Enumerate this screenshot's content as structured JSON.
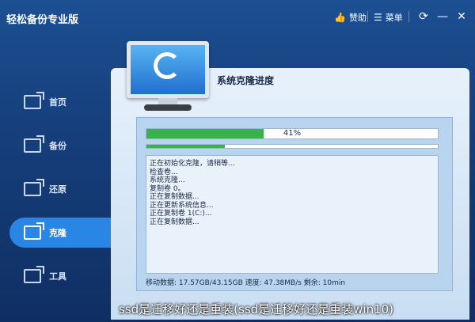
{
  "app": {
    "title": "轻松备份专业版"
  },
  "toolbar": {
    "sponsor_label": "赞助",
    "sponsor_icon": "thumbs-up-icon",
    "menu_label": "菜单",
    "menu_icon": "menu-icon"
  },
  "window": {
    "refresh_icon": "refresh-icon",
    "minimize_icon": "minimize-icon",
    "close_icon": "close-icon"
  },
  "sidebar": {
    "items": [
      {
        "label": "首页",
        "icon": "home-icon"
      },
      {
        "label": "备份",
        "icon": "backup-icon"
      },
      {
        "label": "还原",
        "icon": "restore-icon"
      },
      {
        "label": "克隆",
        "icon": "clone-icon",
        "active": true
      },
      {
        "label": "工具",
        "icon": "tools-icon"
      }
    ]
  },
  "main": {
    "title": "系统克隆进度",
    "progress": {
      "percent_text": "41%",
      "value": 0.41,
      "sub_value": 0.27
    },
    "log": [
      "正在初始化克隆，请稍等...",
      "检查卷...",
      "系统克隆...",
      "复制卷 0。",
      "正在复制数据...",
      "正在更新系统信息...",
      "正在复制卷 1(C:)...",
      "正在复制数据..."
    ],
    "status": "移动数据: 17.57GB/43.15GB 速度: 47.38MB/s 剩余: 10min"
  },
  "caption": "ssd是迁移好还是重装(ssd是迁移好还是重装win10)",
  "colors": {
    "accent": "#2a86e5",
    "progress": "#37b34a",
    "background": "#163f7c"
  }
}
